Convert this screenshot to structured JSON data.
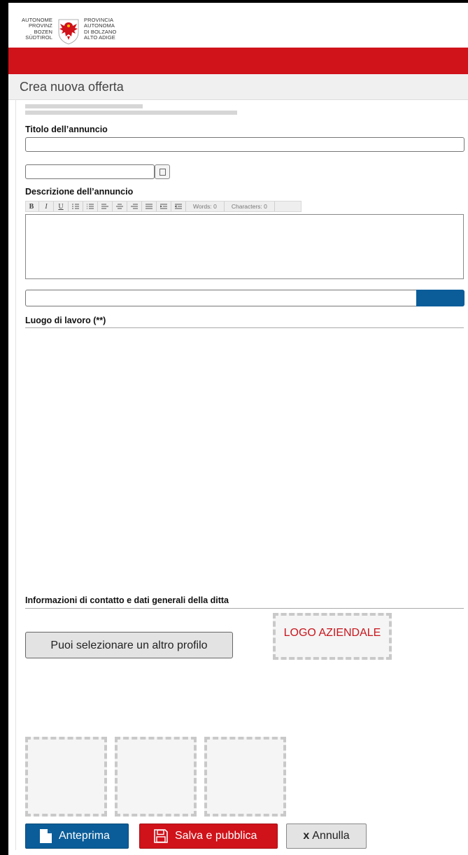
{
  "header": {
    "logo_left_lines": [
      "AUTONOME",
      "PROVINZ",
      "BOZEN",
      "SÜDTIROL"
    ],
    "logo_right_lines": [
      "PROVINCIA",
      "AUTONOMA",
      "DI BOLZANO",
      "ALTO ADIGE"
    ],
    "brand_red": "#d0121a",
    "crest_icon": "eagle-crest-icon"
  },
  "page": {
    "title": "Crea nuova offerta"
  },
  "form": {
    "title_label": "Titolo dell’annuncio",
    "title_value": "",
    "date_value": "",
    "description_label": "Descrizione dell’annuncio",
    "toolbar": {
      "buttons": [
        "B",
        "I",
        "U"
      ],
      "words": "Words: 0",
      "characters": "Characters: 0"
    },
    "location_label": "Luogo di lavoro (**)",
    "contact_label": "Informazioni di contatto e dati generali della ditta",
    "profile_button": "Puoi selezionare un altro profilo",
    "logo_placeholder": "LOGO AZIENDALE"
  },
  "actions": {
    "preview": "Anteprima",
    "save": "Salva e pubblica",
    "cancel_mark": "x",
    "cancel": "Annulla",
    "accent_blue": "#0a5d99"
  }
}
